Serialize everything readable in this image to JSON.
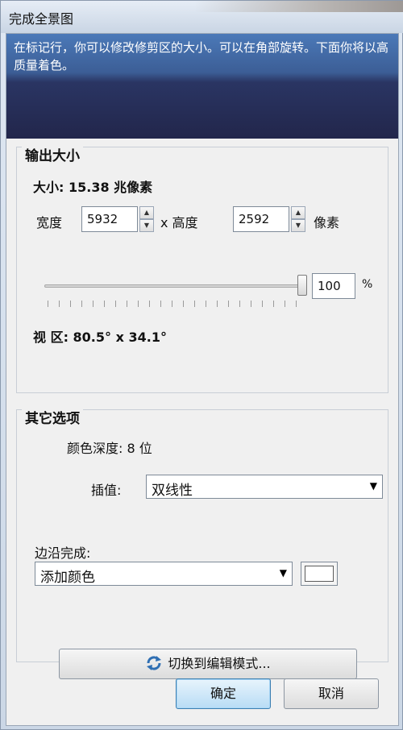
{
  "window": {
    "title": "完成全景图"
  },
  "banner": {
    "text": "在标记行，你可以修改修剪区的大小。可以在角部旋转。下面你将以高质量着色。"
  },
  "output_size": {
    "group_title": "输出大小",
    "size_label": "大小: 15.38 兆像素",
    "width_label": "宽度",
    "width_value": "5932",
    "x_height_label": "x 高度",
    "height_value": "2592",
    "unit_label": "像素",
    "scale_value": "100",
    "percent_label": "%",
    "slider_level_percent": 100,
    "fov_label": "视 区: 80.5° x 34.1°"
  },
  "other_options": {
    "group_title": "其它选项",
    "color_depth": "颜色深度: 8 位",
    "interp_label": "插值:",
    "interp_value": "双线性",
    "edge_label": "边沿完成:",
    "edge_value": "添加颜色",
    "edge_color": "#ffffff",
    "switch_label": "切换到编辑模式..."
  },
  "buttons": {
    "ok": "确定",
    "cancel": "取消"
  },
  "icons": {
    "switch": "refresh-arrows-icon",
    "dropdown": "chevron-down-icon",
    "spin_up": "spin-up-icon",
    "spin_down": "spin-down-icon"
  }
}
